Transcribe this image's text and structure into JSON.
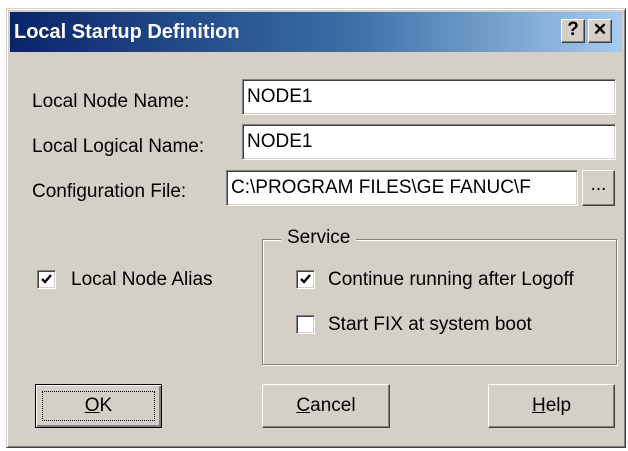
{
  "window": {
    "title": "Local Startup Definition",
    "help_button": "?",
    "close_button": "✕"
  },
  "fields": {
    "node_name": {
      "label": "Local Node Name:",
      "value": "NODE1"
    },
    "logical_name": {
      "label": "Local Logical Name:",
      "value": "NODE1"
    },
    "config_file": {
      "label": "Configuration File:",
      "value": "C:\\PROGRAM FILES\\GE FANUC\\F",
      "browse_label": "..."
    }
  },
  "checkboxes": {
    "local_node_alias": {
      "label": "Local Node Alias",
      "checked": true
    }
  },
  "service": {
    "title": "Service",
    "continue_running": {
      "label": "Continue running after Logoff",
      "checked": true
    },
    "start_fix": {
      "label": "Start FIX at system boot",
      "checked": false
    }
  },
  "buttons": {
    "ok": {
      "mnemonic": "O",
      "rest": "K"
    },
    "cancel": {
      "mnemonic": "C",
      "rest": "ancel"
    },
    "help": {
      "mnemonic": "H",
      "rest": "elp"
    }
  }
}
